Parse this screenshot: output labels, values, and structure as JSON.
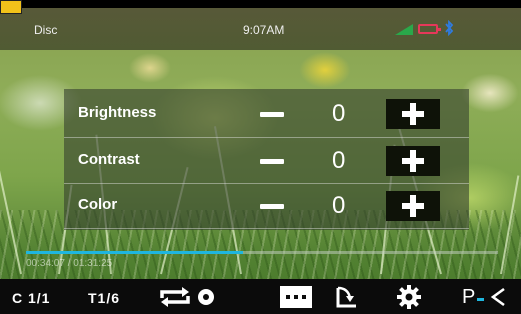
{
  "status_bar": {
    "source": "Disc",
    "time": "9:07AM"
  },
  "adjustments": [
    {
      "label": "Brightness",
      "value": "0"
    },
    {
      "label": "Contrast",
      "value": "0"
    },
    {
      "label": "Color",
      "value": "0"
    }
  ],
  "playback": {
    "progress_fraction": 0.46,
    "elapsed_time": "00:34:07 / 01:31:25"
  },
  "bottom_bar": {
    "chapter": "C 1/1",
    "title": "T1/6",
    "pal_label": "P"
  },
  "colors": {
    "progress": "#1fb6de",
    "battery": "#e6385a",
    "bluetooth": "#2f7be0",
    "signal": "#2aa84a"
  },
  "icons": [
    "signal-icon",
    "battery-icon",
    "bluetooth-icon",
    "repeat-icon",
    "disc-icon",
    "menu-icon",
    "rotate-icon",
    "gear-icon",
    "pal-ntsc-icon"
  ]
}
